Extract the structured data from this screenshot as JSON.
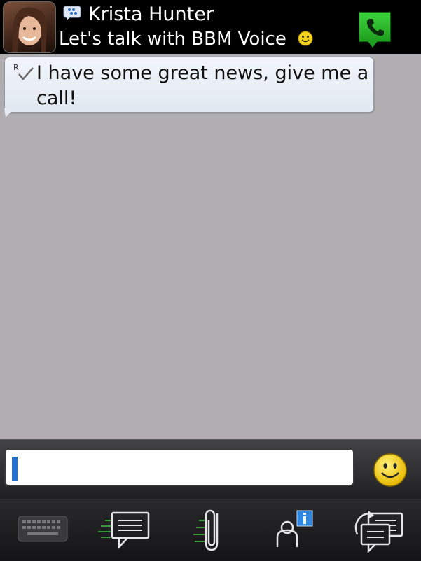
{
  "header": {
    "contact_name": "Krista Hunter",
    "status_message": "Let's talk with BBM Voice",
    "status_emoticon": "smiley-icon",
    "avatar": "contact-avatar",
    "voice_call_icon": "phone-icon"
  },
  "conversation": {
    "messages": [
      {
        "text": "I have some great news, give me a call!",
        "delivery_status": "R",
        "status_icon": "checkmark-icon"
      }
    ]
  },
  "compose": {
    "input_value": "",
    "emoticon_icon": "smiley-icon"
  },
  "toolbar": {
    "items": [
      {
        "icon": "keyboard-icon"
      },
      {
        "icon": "chat-icon"
      },
      {
        "icon": "attachment-icon"
      },
      {
        "icon": "contact-info-icon"
      },
      {
        "icon": "switch-chats-icon"
      }
    ]
  },
  "colors": {
    "header_bg": "#000000",
    "conversation_bg": "#b0aeb0",
    "bubble_bg": "#e8edf5",
    "voice_green": "#2bbd2b",
    "caret_blue": "#1f6fd6",
    "emoticon_yellow": "#f2d21a"
  }
}
